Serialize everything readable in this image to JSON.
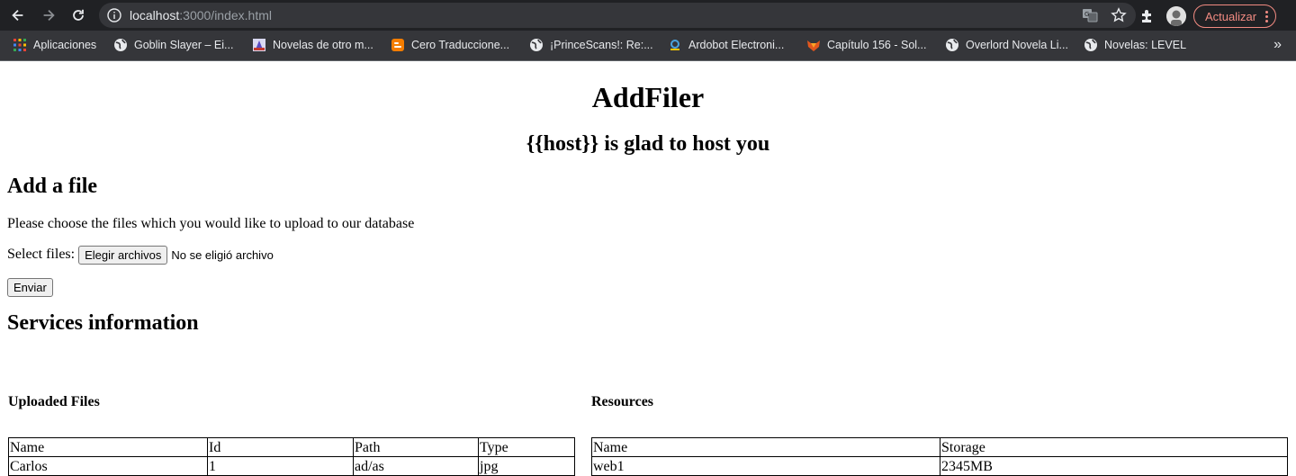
{
  "browser": {
    "url_host": "localhost",
    "url_path": ":3000/index.html",
    "update_label": "Actualizar",
    "bookmarks": [
      {
        "label": "Aplicaciones",
        "icon": "apps-grid-icon"
      },
      {
        "label": "Goblin Slayer – Ei...",
        "icon": "globe-icon"
      },
      {
        "label": "Novelas de otro m...",
        "icon": "site-favicon-icon"
      },
      {
        "label": "Cero Traduccione...",
        "icon": "blogger-icon"
      },
      {
        "label": "¡PrinceScans!: Re:...",
        "icon": "globe-icon"
      },
      {
        "label": "Ardobot Electroni...",
        "icon": "ardobot-icon"
      },
      {
        "label": "Capítulo 156 - Sol...",
        "icon": "fox-icon"
      },
      {
        "label": "Overlord Novela Li...",
        "icon": "globe-icon"
      },
      {
        "label": "Novelas: LEVEL",
        "icon": "globe-icon"
      }
    ],
    "more_label": "»"
  },
  "page": {
    "title": "AddFiler",
    "subtitle": "{{host}} is glad to host you",
    "add_section": {
      "heading": "Add a file",
      "description": "Please choose the files which you would like to upload to our database",
      "select_label": "Select files:",
      "choose_button": "Elegir archivos",
      "no_file_text": "No se eligió archivo",
      "submit_button": "Enviar"
    },
    "services": {
      "heading": "Services information",
      "uploaded": {
        "heading": "Uploaded Files",
        "columns": [
          "Name",
          "Id",
          "Path",
          "Type"
        ],
        "rows": [
          [
            "Carlos",
            "1",
            "ad/as",
            "jpg"
          ]
        ]
      },
      "resources": {
        "heading": "Resources",
        "columns": [
          "Name",
          "Storage"
        ],
        "rows": [
          [
            "web1",
            "2345MB"
          ]
        ]
      }
    }
  }
}
